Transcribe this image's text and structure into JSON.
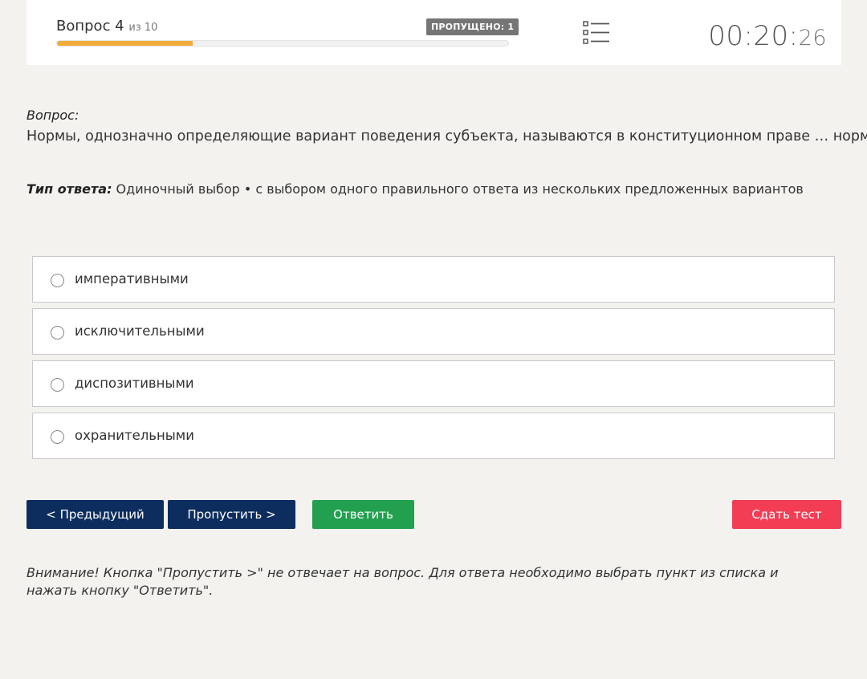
{
  "header": {
    "question_prefix": "Вопрос 4",
    "question_total": "из 10",
    "skipped_badge": "ПРОПУЩЕНО: 1",
    "progress_fraction": 0.3,
    "progress_color": "#f0ad3a",
    "list_icon": "list-icon",
    "timer_main": "00:20:",
    "timer_seconds": "26"
  },
  "question": {
    "label": "Вопрос:",
    "text": "Нормы, однозначно определяющие вариант поведения субъекта, называются в конституционном праве … нормами"
  },
  "answer_type": {
    "label": "Тип ответа:",
    "value": " Одиночный выбор • с выбором одного правильного ответа из нескольких предложенных вариантов"
  },
  "options": [
    {
      "label": "императивными"
    },
    {
      "label": "исключительными"
    },
    {
      "label": "диспозитивными"
    },
    {
      "label": "охранительными"
    }
  ],
  "buttons": {
    "prev": "< Предыдущий",
    "skip": "Пропустить >",
    "answer": "Ответить",
    "submit": "Сдать тест"
  },
  "colors": {
    "nav_button": "#0c2d5e",
    "answer_button": "#22a04f",
    "submit_button": "#f23d55"
  },
  "notice": "Внимание! Кнопка \"Пропустить >\" не отвечает на вопрос. Для ответа необходимо выбрать пункт из списка и нажать кнопку \"Ответить\"."
}
